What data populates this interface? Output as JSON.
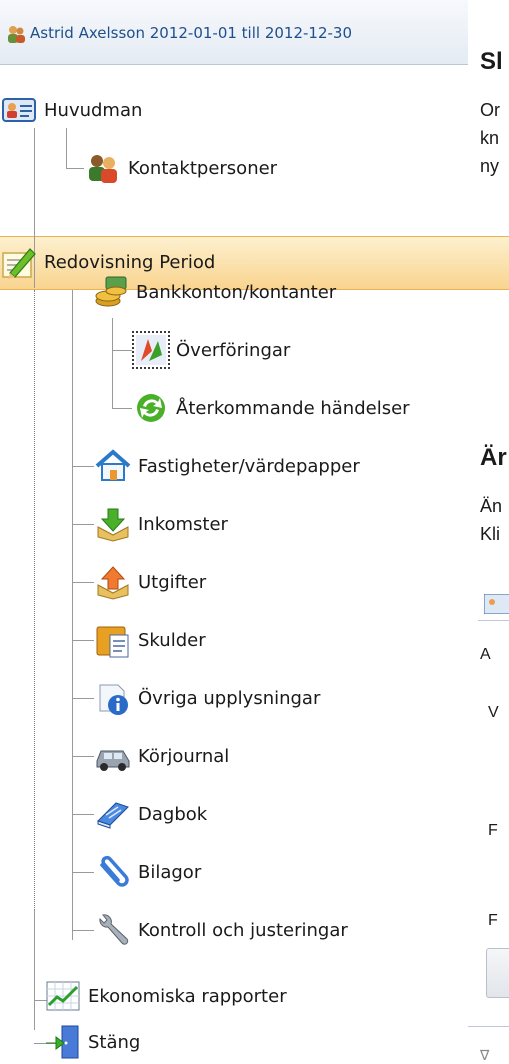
{
  "window": {
    "title": "Astrid Axelsson 2012-01-01 till 2012-12-30"
  },
  "tree": {
    "items": [
      {
        "label": "Huvudman"
      },
      {
        "label": "Kontaktpersoner"
      },
      {
        "label": "Redovisning Period"
      },
      {
        "label": "Bankkonton/kontanter"
      },
      {
        "label": "Överföringar"
      },
      {
        "label": "Återkommande händelser"
      },
      {
        "label": "Fastigheter/värdepapper"
      },
      {
        "label": "Inkomster"
      },
      {
        "label": "Utgifter"
      },
      {
        "label": "Skulder"
      },
      {
        "label": "Övriga upplysningar"
      },
      {
        "label": "Körjournal"
      },
      {
        "label": "Dagbok"
      },
      {
        "label": "Bilagor"
      },
      {
        "label": "Kontroll och justeringar"
      },
      {
        "label": "Ekonomiska rapporter"
      },
      {
        "label": "Stäng"
      }
    ]
  },
  "right_panel": {
    "heading1": "Sl",
    "para1": [
      "Or",
      "kn",
      "ny"
    ],
    "heading2": "Är",
    "para2": [
      "Än",
      "Kli"
    ],
    "rows": [
      "A",
      "V",
      "F",
      "F"
    ]
  }
}
